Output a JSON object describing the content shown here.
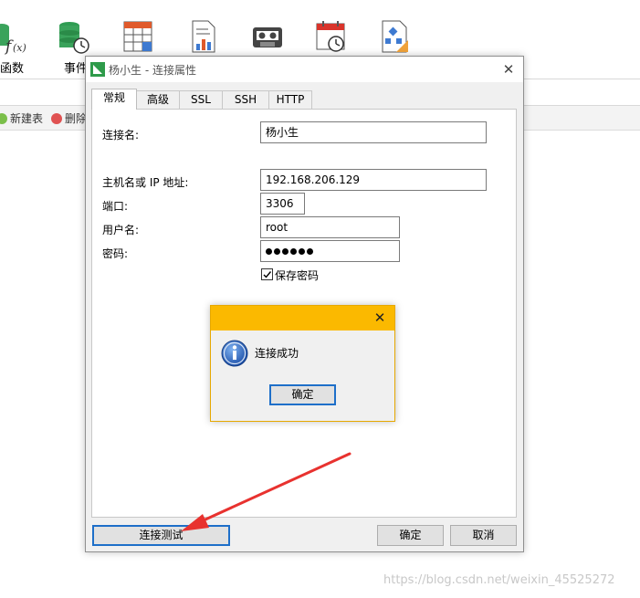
{
  "toolbar": {
    "items": [
      {
        "label": "函数",
        "icon": "function-icon"
      },
      {
        "label": "事件",
        "icon": "event-icon"
      },
      {
        "label": "",
        "icon": "table-icon"
      },
      {
        "label": "",
        "icon": "report-icon"
      },
      {
        "label": "",
        "icon": "backup-icon"
      },
      {
        "label": "",
        "icon": "schedule-icon"
      },
      {
        "label": "",
        "icon": "model-icon"
      }
    ]
  },
  "object_bar": {
    "new_table": "新建表",
    "delete": "删除"
  },
  "dialog": {
    "title": "杨小生 - 连接属性",
    "tabs": [
      "常规",
      "高级",
      "SSL",
      "SSH",
      "HTTP"
    ],
    "active_tab": "常规",
    "fields": {
      "connection_name_label": "连接名:",
      "connection_name_value": "杨小生",
      "host_label": "主机名或 IP 地址:",
      "host_value": "192.168.206.129",
      "port_label": "端口:",
      "port_value": "3306",
      "username_label": "用户名:",
      "username_value": "root",
      "password_label": "密码:",
      "password_dots": 6,
      "save_password_label": "保存密码",
      "save_password_checked": true
    },
    "buttons": {
      "test_connection": "连接测试",
      "ok": "确定",
      "cancel": "取消"
    }
  },
  "message_box": {
    "message": "连接成功",
    "ok": "确定",
    "accent_color": "#fbb900"
  },
  "annotation": {
    "arrow_color": "#e8322f"
  },
  "watermark": "https://blog.csdn.net/weixin_45525272"
}
